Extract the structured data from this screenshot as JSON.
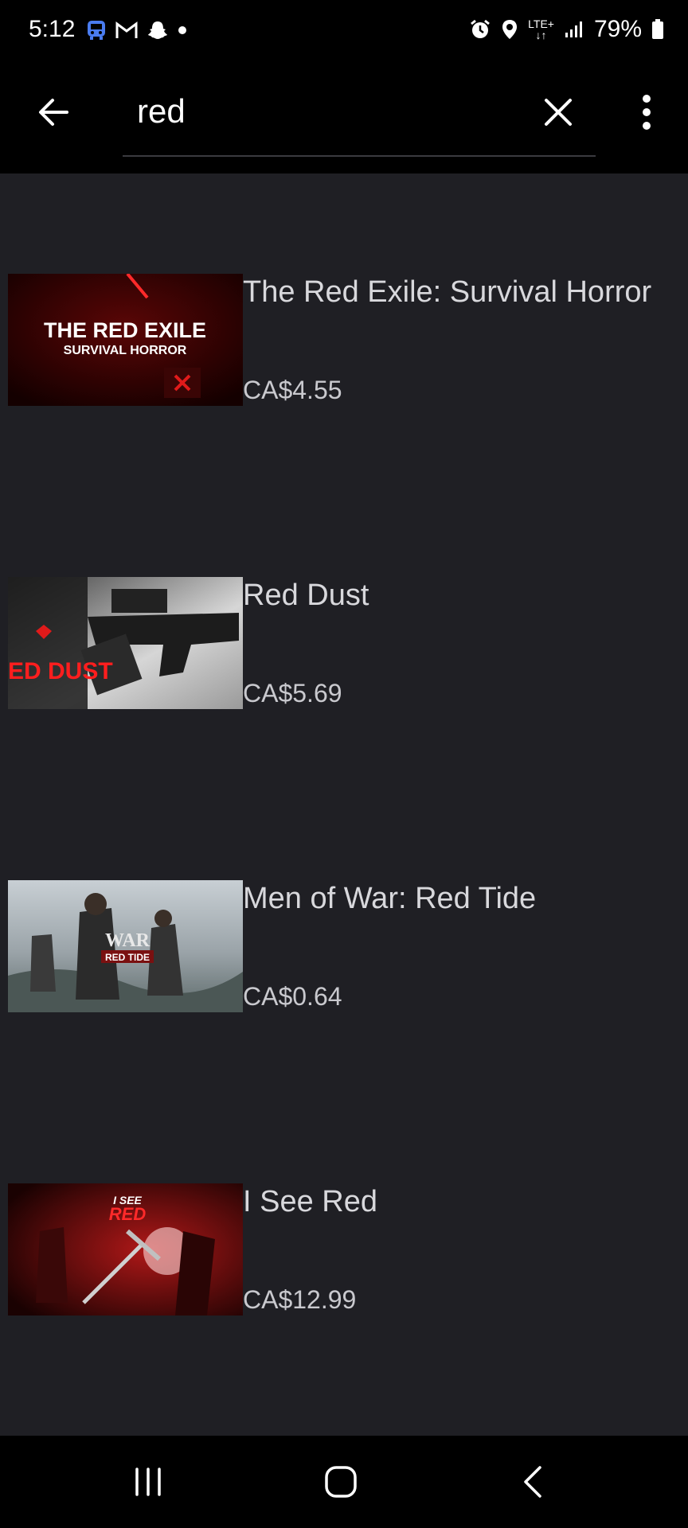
{
  "status_bar": {
    "time": "5:12",
    "battery": "79%",
    "network": "LTE+",
    "icons": [
      "bus-icon",
      "gmail-icon",
      "snapchat-icon",
      "dot-icon",
      "alarm-icon",
      "location-icon",
      "lte-icon",
      "signal-icon",
      "battery-icon"
    ]
  },
  "search": {
    "value": "red",
    "placeholder": ""
  },
  "results": [
    {
      "title": "The Red Exile: Survival Horror",
      "price": "CA$4.55",
      "thumb_text_1": "THE RED EXILE",
      "thumb_text_2": "SURVIVAL HORROR"
    },
    {
      "title": "Red Dust",
      "price": "CA$5.69",
      "thumb_text_1": "RED DUST"
    },
    {
      "title": "Men of War: Red Tide",
      "price": "CA$0.64",
      "thumb_text_1": "WAR",
      "thumb_text_2": "RED TIDE"
    },
    {
      "title": "I See Red",
      "price": "CA$12.99",
      "thumb_text_1": "I SEE",
      "thumb_text_2": "RED"
    }
  ],
  "colors": {
    "background": "#1f1f24",
    "bar": "#000000",
    "accent_red": "#e01a1a",
    "text": "#d8d8dc"
  }
}
